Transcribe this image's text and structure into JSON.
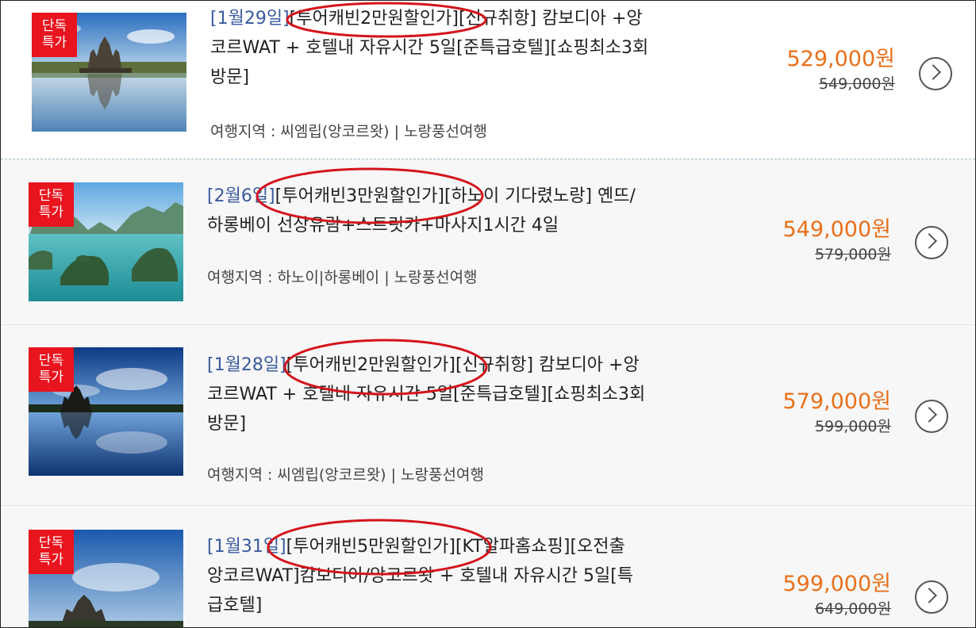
{
  "colors": {
    "accent_price": "#e8701a",
    "badge_bg": "#e8141e",
    "date_link": "#3a5a9c",
    "annotation": "#d4141c"
  },
  "products": [
    {
      "badge": "단독\n특가",
      "date": "[1월29일]",
      "title_rest": "[투어캐빈2만원할인가][신규취항] 캄보디아 +앙",
      "line2": "코르WAT + 호텔내 자유시간 5일[준특급호텔][쇼핑최소3회",
      "line3": "방문]",
      "region": "여행지역 : 씨엠립(앙코르왓) | 노랑풍선여행",
      "sale_price": "529,000원",
      "orig_price": "549,000원",
      "thumb": "angkor-wat-image"
    },
    {
      "badge": "단독\n특가",
      "date": "[2월6일]",
      "title_rest": "[투어캐빈3만원할인가][하노이 기다렸노랑] 옌뜨/",
      "line2": "하롱베이 선상유람+스트릿카+마사지1시간 4일",
      "line3": "",
      "region": "여행지역 : 하노이|하롱베이 | 노랑풍선여행",
      "sale_price": "549,000원",
      "orig_price": "579,000원",
      "thumb": "halong-bay-image"
    },
    {
      "badge": "단독\n특가",
      "date": "[1월28일]",
      "title_rest": "[투어캐빈2만원할인가][신규취항] 캄보디아 +앙",
      "line2": "코르WAT + 호텔내 자유시간 5일[준특급호텔][쇼핑최소3회",
      "line3": "방문]",
      "region": "여행지역 : 씨엠립(앙코르왓) | 노랑풍선여행",
      "sale_price": "579,000원",
      "orig_price": "599,000원",
      "thumb": "angkor-wat-image"
    },
    {
      "badge": "단독\n특가",
      "date": "[1월31일]",
      "title_rest": "[투어캐빈5만원할인가][KT알파홈쇼핑][오전출",
      "line2": "앙코르WAT]캄보디아/앙코르왓 + 호텔내 자유시간 5일[특",
      "line3": "급호텔]",
      "region": "",
      "sale_price": "599,000원",
      "orig_price": "649,000원",
      "thumb": "angkor-wat-image"
    }
  ]
}
